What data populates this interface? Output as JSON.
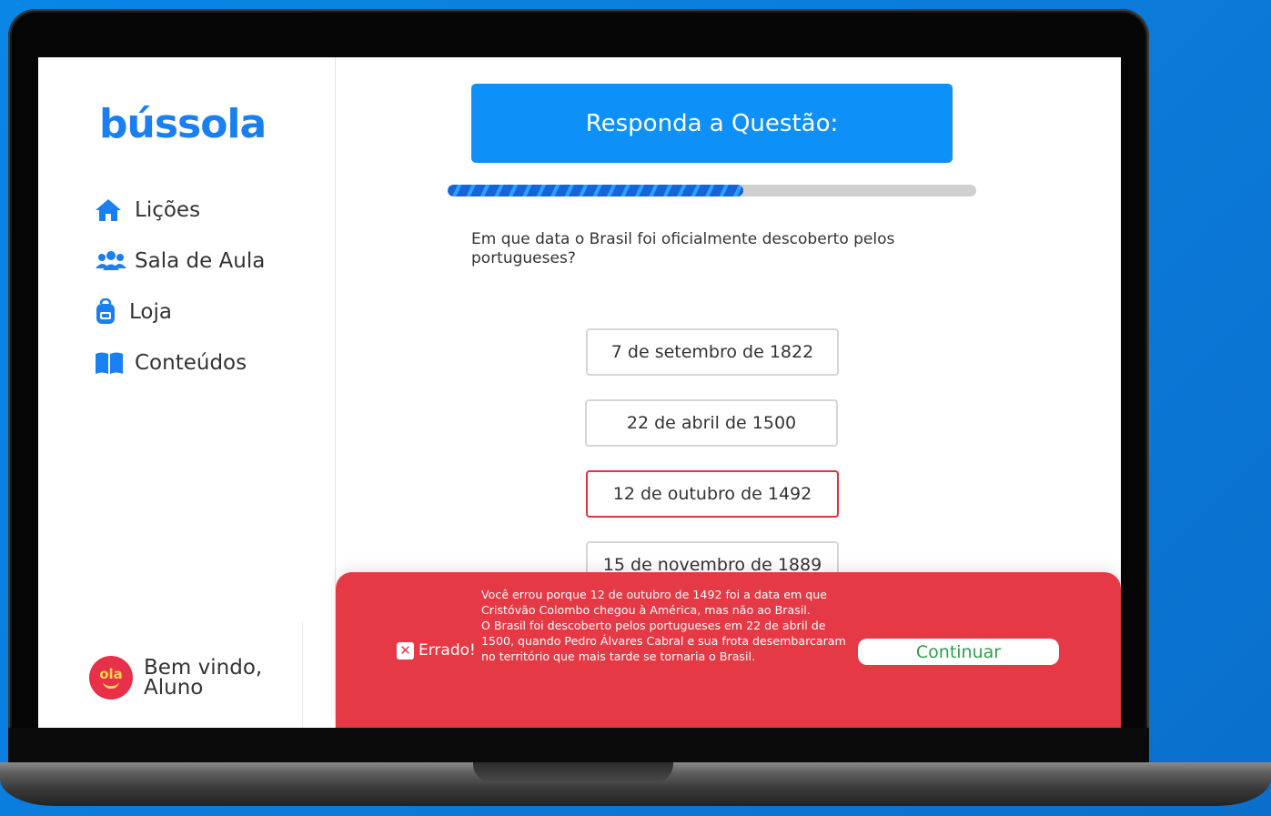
{
  "brand": {
    "logo_text": "bússola",
    "color": "#1a7ff0"
  },
  "sidebar": {
    "items": [
      {
        "label": "Lições",
        "icon": "home-icon"
      },
      {
        "label": "Sala de Aula",
        "icon": "users-icon"
      },
      {
        "label": "Loja",
        "icon": "backpack-icon"
      },
      {
        "label": "Conteúdos",
        "icon": "book-icon"
      }
    ],
    "welcome": {
      "avatar_text": "ola",
      "line1": "Bem vindo,",
      "line2": "Aluno"
    }
  },
  "quiz": {
    "header": "Responda a Questão:",
    "progress_fraction": 0.56,
    "question": "Em que data o Brasil foi oficialmente descoberto pelos portugueses?",
    "options": [
      {
        "label": "7 de setembro de 1822",
        "state": "default"
      },
      {
        "label": "22 de abril de 1500",
        "state": "default"
      },
      {
        "label": "12 de outubro de 1492",
        "state": "wrong"
      },
      {
        "label": "15 de novembro de 1889",
        "state": "default"
      }
    ]
  },
  "feedback": {
    "status": "Errado!",
    "message_1": "Você errou porque 12 de outubro de 1492 foi a data em que Cristóvão Colombo chegou à América, mas não ao Brasil.",
    "message_2": "O Brasil foi descoberto pelos portugueses em 22 de abril de 1500, quando Pedro Álvares Cabral e sua frota desembarcaram no território que mais tarde se tornaria o Brasil.",
    "continue_label": "Continuar",
    "background_color": "#e53945"
  }
}
